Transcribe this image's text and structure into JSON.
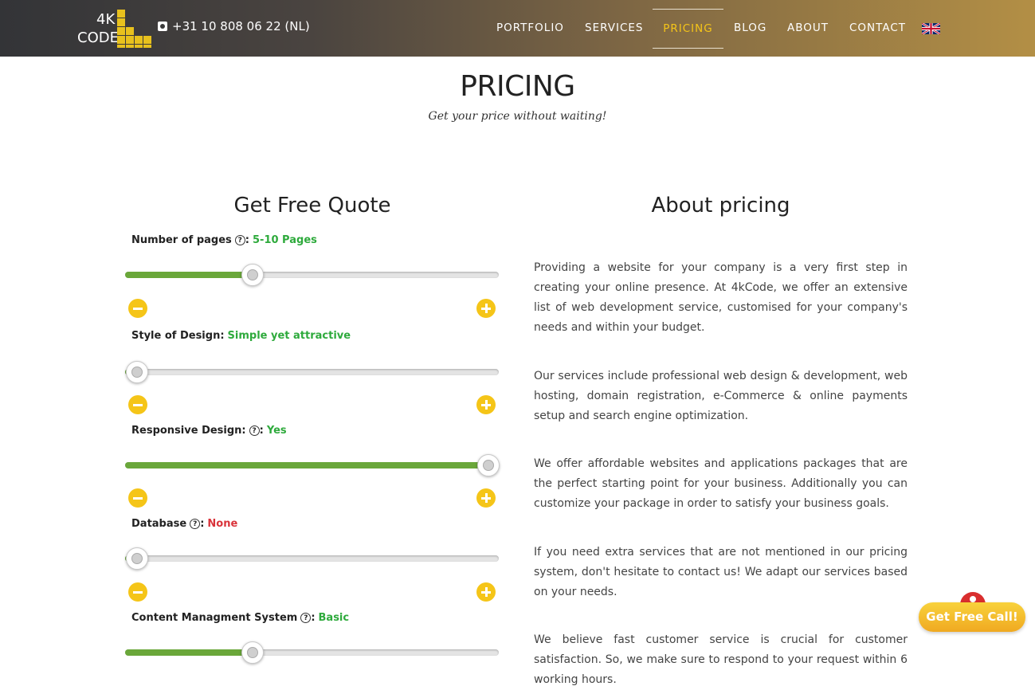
{
  "header": {
    "logo": {
      "line1": "4K",
      "line2": "CODE"
    },
    "phone": "+31 10 808 06 22 (NL)",
    "nav": [
      {
        "label": "PORTFOLIO",
        "active": false
      },
      {
        "label": "SERVICES",
        "active": false
      },
      {
        "label": "PRICING",
        "active": true
      },
      {
        "label": "BLOG",
        "active": false
      },
      {
        "label": "ABOUT",
        "active": false
      },
      {
        "label": "CONTACT",
        "active": false
      }
    ],
    "language_icon": "uk-flag-icon"
  },
  "page": {
    "title": "PRICING",
    "subtitle": "Get your price without waiting!"
  },
  "quote": {
    "title": "Get Free Quote",
    "sliders": [
      {
        "label": "Number of pages",
        "help": true,
        "separator": ":",
        "value": "5-10 Pages",
        "value_color": "green",
        "level": 0.34
      },
      {
        "label": "Style of Design",
        "help": false,
        "separator": ":",
        "value": "Simple yet attractive",
        "value_color": "green",
        "level": 0.03
      },
      {
        "label": "Responsive Design:",
        "help": true,
        "separator": ":",
        "value": "Yes",
        "value_color": "green",
        "level": 0.97
      },
      {
        "label": "Database",
        "help": true,
        "separator": ":",
        "value": "None",
        "value_color": "red",
        "level": 0.03
      },
      {
        "label": "Content Managment System",
        "help": true,
        "separator": " :",
        "value": "Basic",
        "value_color": "green",
        "level": 0.34
      }
    ]
  },
  "about": {
    "title": "About pricing",
    "paragraphs": [
      "Providing a website for your company is a very first step in creating your online presence. At 4kCode, we offer an extensive list of web development service, customised for your company's needs and within your budget.",
      "Our services include professional web design & development, web hosting, domain registration, e-Commerce & online payments setup and search engine optimization.",
      "We offer affordable websites and applications packages that are the perfect starting point for your business. Additionally you can customize your package in order to satisfy your business goals.",
      "If you need extra services that are not mentioned in our pricing system, don't hesitate to contact us! We adapt our services based on your needs.",
      "We believe fast customer service is crucial for customer satisfaction. So, we make sure to respond to your request within 6 working hours."
    ]
  },
  "cta": {
    "label": "Get Free Call!"
  },
  "colors": {
    "accent": "#f5c518",
    "green": "#2eaa3c",
    "red": "#d9333a",
    "slider_fill": "#6aa73a"
  }
}
